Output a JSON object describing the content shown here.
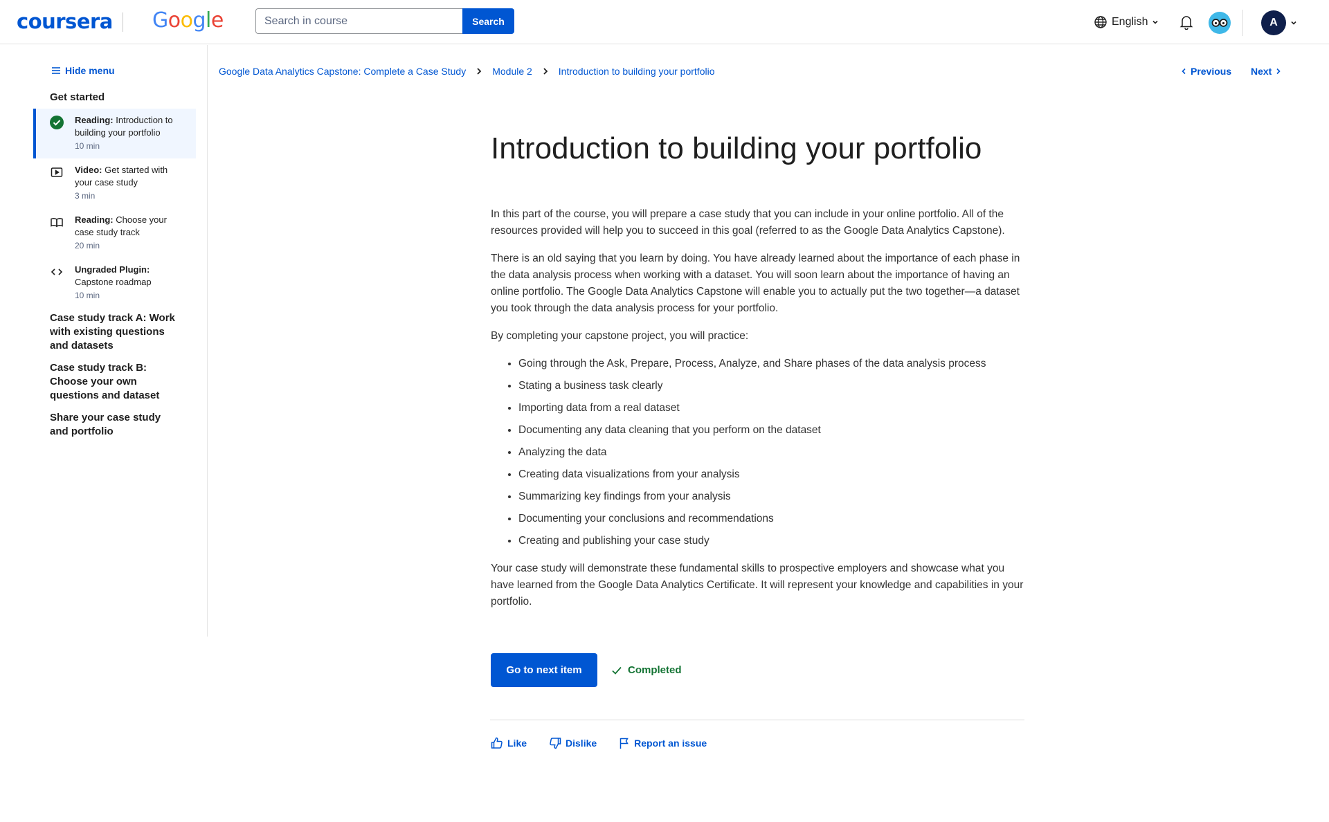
{
  "header": {
    "logo_coursera": "coursera",
    "logo_google": [
      "G",
      "o",
      "o",
      "g",
      "l",
      "e"
    ],
    "search_placeholder": "Search in course",
    "search_button": "Search",
    "language": "English",
    "avatar_initial": "A"
  },
  "sidebar": {
    "hide_menu": "Hide menu",
    "section_get_started": "Get started",
    "items": [
      {
        "type": "Reading:",
        "title": "Introduction to building your portfolio",
        "duration": "10 min",
        "icon": "check-circle-icon",
        "active": true
      },
      {
        "type": "Video:",
        "title": "Get started with your case study",
        "duration": "3 min",
        "icon": "play-icon",
        "active": false
      },
      {
        "type": "Reading:",
        "title": "Choose your case study track",
        "duration": "20 min",
        "icon": "book-icon",
        "active": false
      },
      {
        "type": "Ungraded Plugin:",
        "title": "Capstone roadmap",
        "duration": "10 min",
        "icon": "code-icon",
        "active": false
      }
    ],
    "sections": [
      "Case study track A: Work with existing questions and datasets",
      "Case study track B: Choose your own questions and dataset",
      "Share your case study and portfolio"
    ]
  },
  "breadcrumb": {
    "course": "Google Data Analytics Capstone: Complete a Case Study",
    "module": "Module 2",
    "item": "Introduction to building your portfolio"
  },
  "nav": {
    "previous": "Previous",
    "next": "Next"
  },
  "main": {
    "title": "Introduction to building your portfolio",
    "para1": "In this part of the course, you will prepare a case study that you can include in your online portfolio. All of the resources provided will help you to succeed in this goal (referred to as the Google Data Analytics Capstone).",
    "para2": "There is an old saying that you learn by doing. You have already learned about the importance of each phase in the data analysis process when working with a dataset. You will soon learn about the importance of having an online portfolio. The Google Data Analytics Capstone will enable you to actually put the two together—a dataset you took through the data analysis process for your portfolio.",
    "para3": "By completing your capstone project, you will practice:",
    "bullets": [
      "Going through the Ask, Prepare, Process, Analyze, and Share phases of the data analysis process",
      "Stating a business task clearly",
      "Importing data from a real dataset",
      "Documenting any data cleaning that you perform on the dataset",
      "Analyzing the data",
      "Creating data visualizations from your analysis",
      "Summarizing key findings from your analysis",
      "Documenting your conclusions and recommendations",
      "Creating and publishing your case study"
    ],
    "para4": "Your case study will demonstrate these fundamental skills to prospective employers and showcase what you have learned from the Google Data Analytics Certificate. It will represent your knowledge and capabilities in your portfolio."
  },
  "actions": {
    "next_item": "Go to next item",
    "completed": "Completed"
  },
  "feedback": {
    "like": "Like",
    "dislike": "Dislike",
    "report": "Report an issue"
  },
  "colors": {
    "accent": "#0056d2",
    "success": "#137333",
    "active_bg": "#f0f6ff"
  }
}
